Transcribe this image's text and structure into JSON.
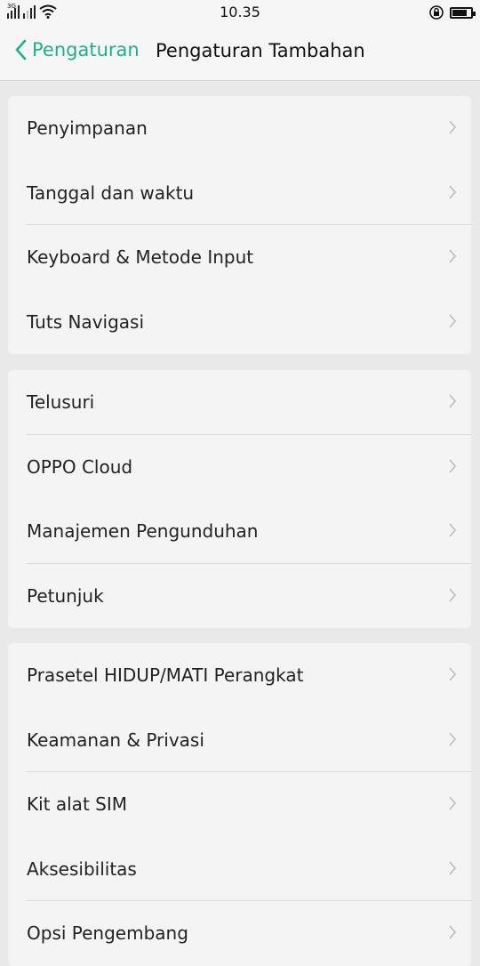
{
  "status": {
    "network_tag": "3G",
    "time": "10.35"
  },
  "header": {
    "back_label": "Pengaturan",
    "title": "Pengaturan Tambahan"
  },
  "groups": [
    {
      "items": [
        {
          "label": "Penyimpanan"
        },
        {
          "label": "Tanggal dan waktu"
        },
        {
          "label": "Keyboard & Metode Input"
        },
        {
          "label": "Tuts Navigasi"
        }
      ]
    },
    {
      "items": [
        {
          "label": "Telusuri"
        },
        {
          "label": "OPPO Cloud"
        },
        {
          "label": "Manajemen Pengunduhan"
        },
        {
          "label": "Petunjuk"
        }
      ]
    },
    {
      "items": [
        {
          "label": "Prasetel HIDUP/MATI Perangkat"
        },
        {
          "label": "Keamanan & Privasi"
        },
        {
          "label": "Kit alat SIM"
        },
        {
          "label": "Aksesibilitas"
        },
        {
          "label": "Opsi Pengembang"
        }
      ]
    }
  ],
  "colors": {
    "accent": "#1fb085"
  }
}
